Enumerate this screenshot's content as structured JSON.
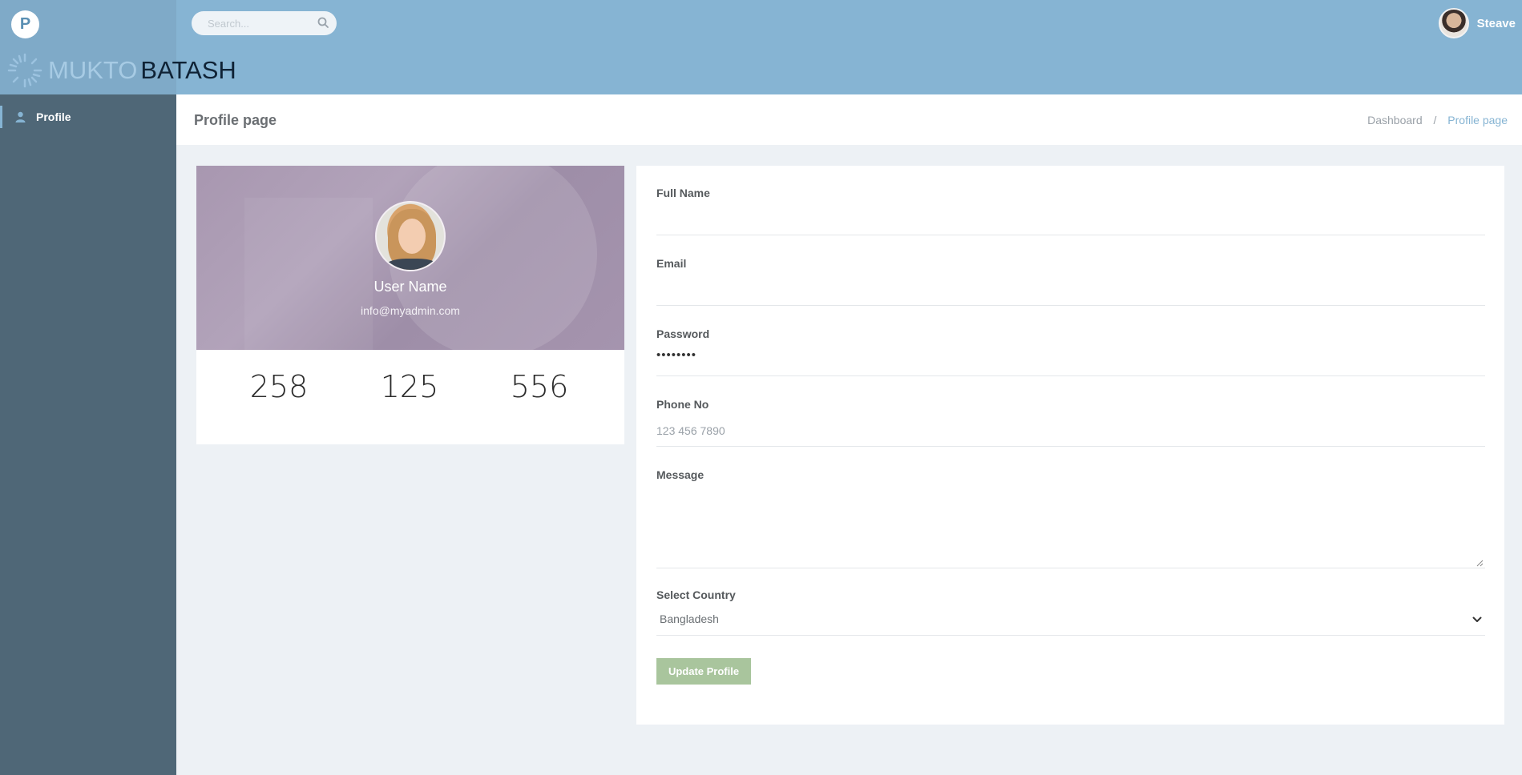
{
  "brand": {
    "logo_letter": "P",
    "name_part1": "MUKTO",
    "name_part2": "BATASH"
  },
  "search": {
    "placeholder": "Search..."
  },
  "user": {
    "name": "Steave"
  },
  "sidebar": {
    "items": [
      {
        "label": "Profile",
        "icon": "user-icon"
      }
    ]
  },
  "page": {
    "title": "Profile page",
    "breadcrumb": [
      "Dashboard",
      "Profile page"
    ]
  },
  "profile": {
    "name": "User Name",
    "email": "info@myadmin.com",
    "stats": [
      "258",
      "125",
      "556"
    ]
  },
  "form": {
    "full_name": {
      "label": "Full Name",
      "value": ""
    },
    "email": {
      "label": "Email",
      "value": ""
    },
    "password": {
      "label": "Password",
      "value": "••••••••"
    },
    "phone": {
      "label": "Phone No",
      "placeholder": "123 456 7890"
    },
    "message": {
      "label": "Message",
      "value": ""
    },
    "country": {
      "label": "Select Country",
      "selected": "Bangladesh"
    },
    "submit_label": "Update Profile"
  },
  "colors": {
    "topbar": "#86b4d3",
    "sidebar": "#4f6777",
    "button": "#a9c59d",
    "accent": "#86b4d3"
  }
}
